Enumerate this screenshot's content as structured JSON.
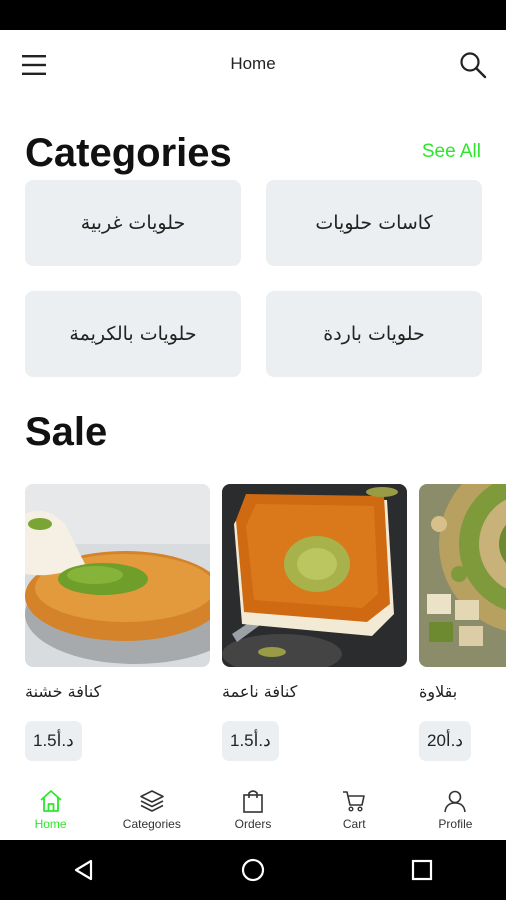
{
  "app_bar": {
    "title": "Home"
  },
  "categories": {
    "title": "Categories",
    "see_all": "See All",
    "items": [
      {
        "label": "حلويات غربية"
      },
      {
        "label": "كاسات حلويات"
      },
      {
        "label": "حلويات بالكريمة"
      },
      {
        "label": "حلويات باردة"
      }
    ]
  },
  "sale": {
    "title": "Sale",
    "items": [
      {
        "name": "كنافة خشنة",
        "price": "1.5د.أ"
      },
      {
        "name": "كنافة ناعمة",
        "price": "1.5د.أ"
      },
      {
        "name": "بقلاوة",
        "price": "20د.أ"
      }
    ]
  },
  "bottom_nav": {
    "active_color": "#2ee62e",
    "items": [
      {
        "label": "Home",
        "icon": "home-icon"
      },
      {
        "label": "Categories",
        "icon": "layers-icon"
      },
      {
        "label": "Orders",
        "icon": "shopping-bag-icon"
      },
      {
        "label": "Cart",
        "icon": "cart-icon"
      },
      {
        "label": "Profile",
        "icon": "user-icon"
      }
    ]
  }
}
